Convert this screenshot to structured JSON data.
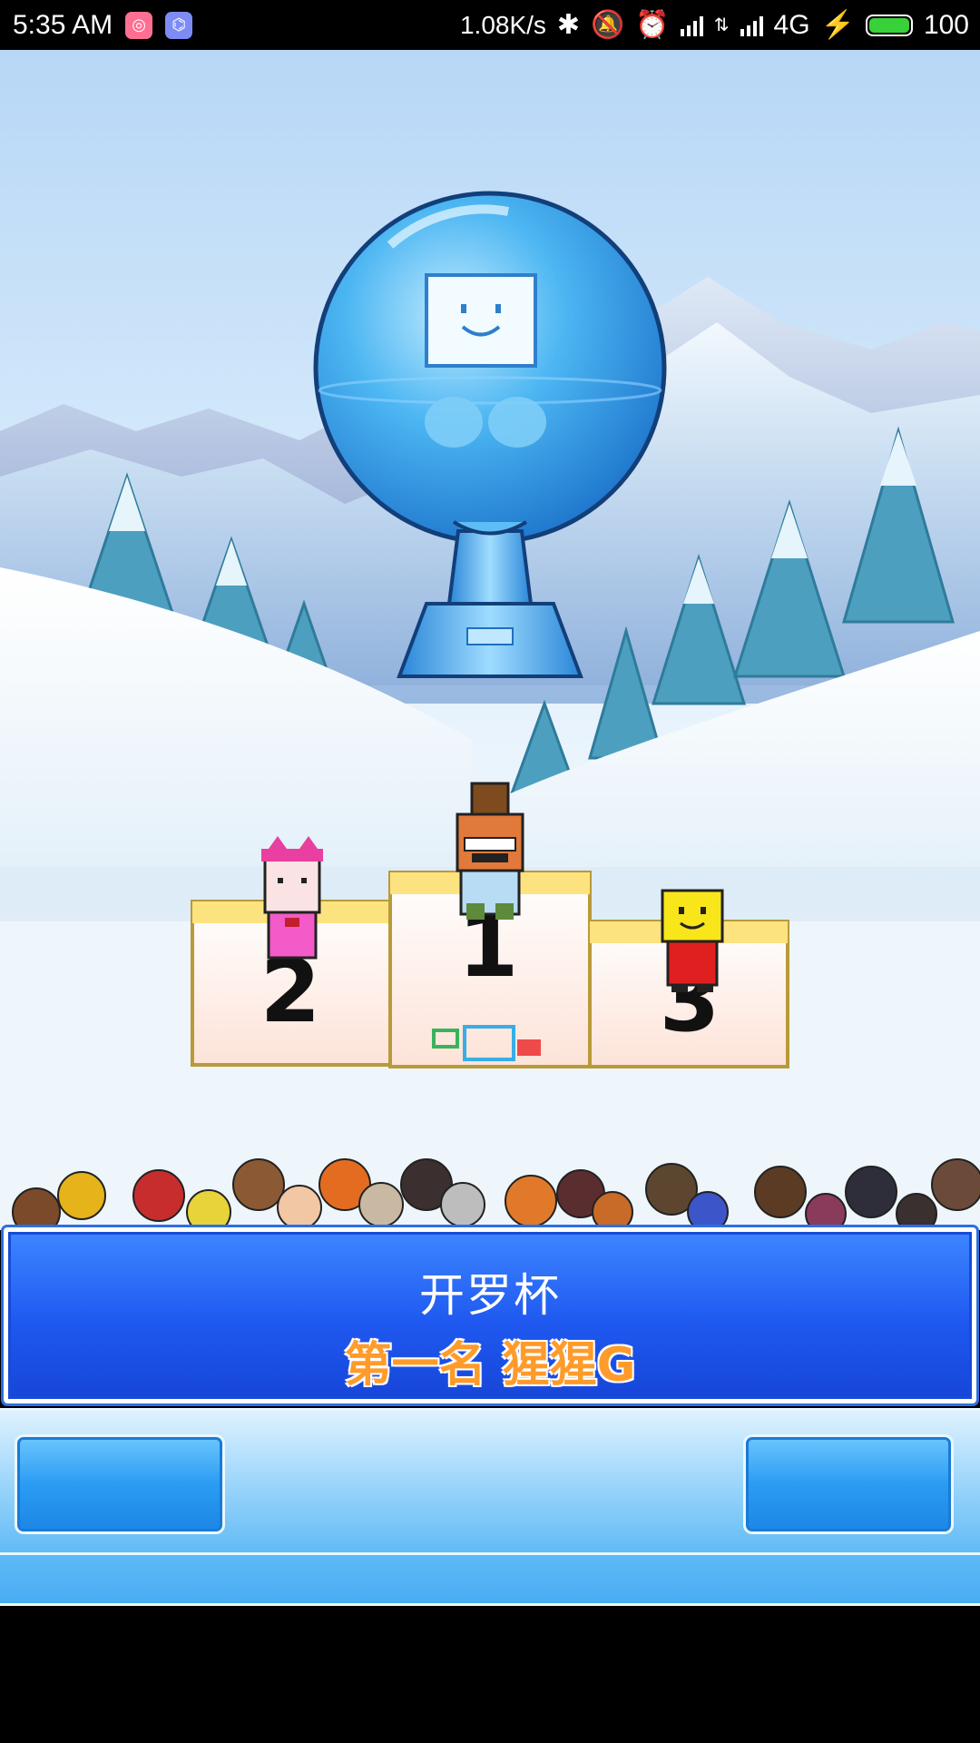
{
  "status_bar": {
    "time": "5:35",
    "ampm": "AM",
    "net_speed": "1.08K/s",
    "network_type": "4G",
    "battery_level": "100",
    "icons": [
      "app-icon-pink",
      "app-icon-blue",
      "bluetooth-icon",
      "mute-icon",
      "alarm-icon",
      "signal-icon",
      "data-arrows-icon",
      "signal-icon",
      "charging-icon",
      "battery-icon"
    ]
  },
  "podium": {
    "first": "1",
    "second": "2",
    "third": "3"
  },
  "dialog": {
    "title": "开罗杯",
    "result": "第一名 猩猩G"
  },
  "colors": {
    "dialog_bg": "#1f58f0",
    "result_text": "#ff9b2a",
    "bottom_bar": "#5bb8f5"
  }
}
